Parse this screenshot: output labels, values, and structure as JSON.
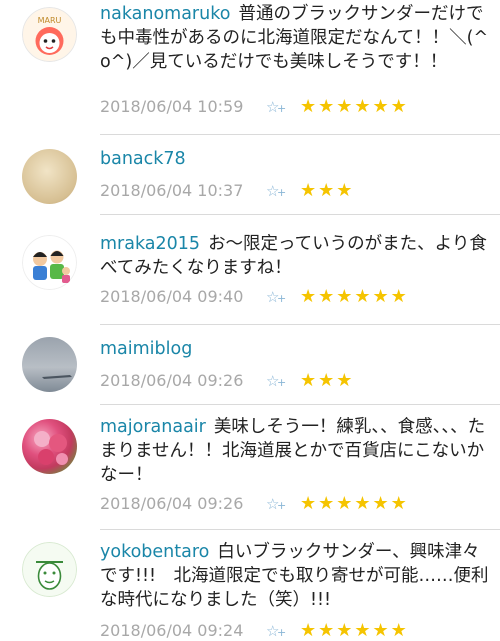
{
  "colors": {
    "username": "#1a86a8",
    "star": "#f5c400",
    "timestamp": "#a8a8a8",
    "add_star_icon": "#8ab6d6"
  },
  "comments": [
    {
      "user": "nakanomaruko",
      "text": "普通のブラックサンダーだけでも中毒性があるのに北海道限定だなんて！！＼(^o^)／見ているだけでも美味しそうです！！",
      "time": "2018/06/04 10:59",
      "stars": "★★★★★★"
    },
    {
      "user": "banack78",
      "text": "",
      "time": "2018/06/04 10:37",
      "stars": "★★★"
    },
    {
      "user": "mraka2015",
      "text": "お〜限定っていうのがまた、より食べてみたくなりますね！",
      "time": "2018/06/04 09:40",
      "stars": "★★★★★★"
    },
    {
      "user": "maimiblog",
      "text": "",
      "time": "2018/06/04 09:26",
      "stars": "★★★"
    },
    {
      "user": "majoranaair",
      "text": "美味しそう一！練乳、、食感、、、たまりません！！北海道展とかで百貨店にこないかなー！",
      "time": "2018/06/04 09:26",
      "stars": "★★★★★★"
    },
    {
      "user": "yokobentaro",
      "text": "白いブラックサンダー、興味津々です!!!　北海道限定でも取り寄せが可能……便利な時代になりました（笑）!!!",
      "time": "2018/06/04 09:24",
      "stars": "★★★★★★"
    }
  ]
}
